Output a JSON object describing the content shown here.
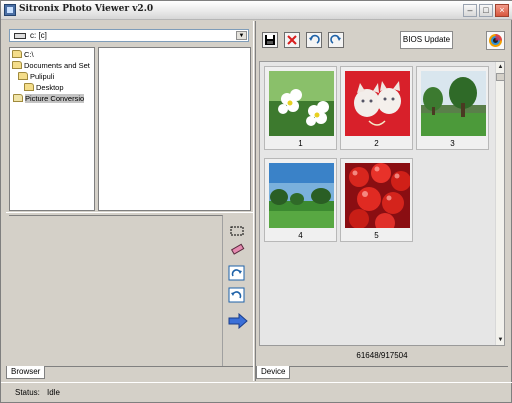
{
  "window": {
    "title": "Sitronix Photo Viewer v2.0"
  },
  "browser": {
    "drive_value": "c: [c]",
    "tree": [
      {
        "label": "C:\\",
        "level": 0,
        "selected": false
      },
      {
        "label": "Documents and Set",
        "level": 0,
        "selected": false
      },
      {
        "label": "Pulipuli",
        "level": 1,
        "selected": false
      },
      {
        "label": "Desktop",
        "level": 2,
        "selected": false
      },
      {
        "label": "Picture Conversio",
        "level": 3,
        "selected": true
      }
    ],
    "tab_label": "Browser"
  },
  "device": {
    "bios_button_label": "BIOS Update",
    "thumbnails": [
      {
        "caption": "1",
        "subject": "white flowers"
      },
      {
        "caption": "2",
        "subject": "kittens"
      },
      {
        "caption": "3",
        "subject": "tree on lawn"
      },
      {
        "caption": "4",
        "subject": "park landscape"
      },
      {
        "caption": "5",
        "subject": "cherries"
      }
    ],
    "memory_counter": "61648/917504",
    "tab_label": "Device"
  },
  "status": {
    "label": "Status:",
    "value": "Idle"
  },
  "icons": {
    "save": "save-icon",
    "delete": "delete-icon",
    "rotate_left": "rotate-left-icon",
    "rotate_right": "rotate-right-icon",
    "camera": "camera-icon",
    "select_area": "select-area-icon",
    "eraser": "eraser-icon",
    "transfer": "arrow-right-icon"
  },
  "colors": {
    "accent": "#3a6fd8",
    "delete": "#d81e1e"
  }
}
